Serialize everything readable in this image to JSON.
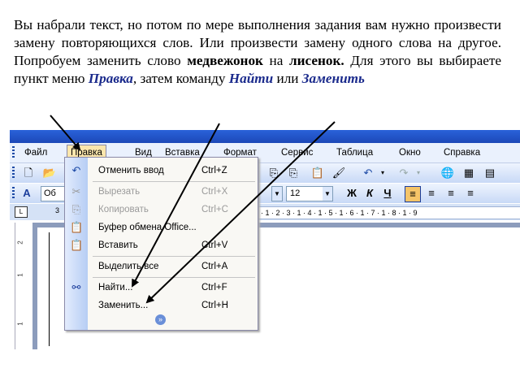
{
  "instruction": {
    "p1": "Вы набрали текст, но потом по мере выполнения задания вам нужно произвести замену повторяющихся слов. Или произвести замену одного слова на другое. Попробуем заменить слово ",
    "word1": "медвежонок",
    "mid": " на ",
    "word2": "лисенок.",
    "p2": " Для этого вы выбираете пункт меню ",
    "menu_pravka": "Правка",
    "p3": ", затем команду ",
    "cmd_find": "Найти",
    "p4": " или ",
    "cmd_replace": "Заменить"
  },
  "menubar": {
    "items": [
      "Файл",
      "Правка",
      "Вид",
      "Вставка",
      "Формат",
      "Сервис",
      "Таблица",
      "Окно",
      "Справка"
    ],
    "active": "Правка"
  },
  "toolbar": {
    "style_value": "Об",
    "font_size": "12"
  },
  "ruler": {
    "tab_marker": "L",
    "left_mark": "3",
    "marks": "· 1 · 2 · 3 · 1 · 4 · 1 · 5 · 1 · 6 · 1 · 7 · 1 · 8 · 1 · 9",
    "vmarks": [
      "2",
      "1",
      "1"
    ]
  },
  "edit_menu": {
    "items": [
      {
        "icon": "undo-icon",
        "label": "Отменить ввод",
        "shortcut": "Ctrl+Z",
        "enabled": true
      },
      {
        "icon": "cut-icon",
        "label": "Вырезать",
        "shortcut": "Ctrl+X",
        "enabled": false
      },
      {
        "icon": "copy-icon",
        "label": "Копировать",
        "shortcut": "Ctrl+C",
        "enabled": false
      },
      {
        "icon": "clipboard-icon",
        "label": "Буфер обмена Office...",
        "shortcut": "",
        "enabled": true
      },
      {
        "icon": "paste-icon",
        "label": "Вставить",
        "shortcut": "Ctrl+V",
        "enabled": true
      },
      {
        "icon": "",
        "label": "Выделить все",
        "shortcut": "Ctrl+A",
        "enabled": true
      },
      {
        "icon": "binoculars-icon",
        "label": "Найти...",
        "shortcut": "Ctrl+F",
        "enabled": true
      },
      {
        "icon": "",
        "label": "Заменить...",
        "shortcut": "Ctrl+H",
        "enabled": true
      }
    ],
    "expand_glyph": "»"
  }
}
